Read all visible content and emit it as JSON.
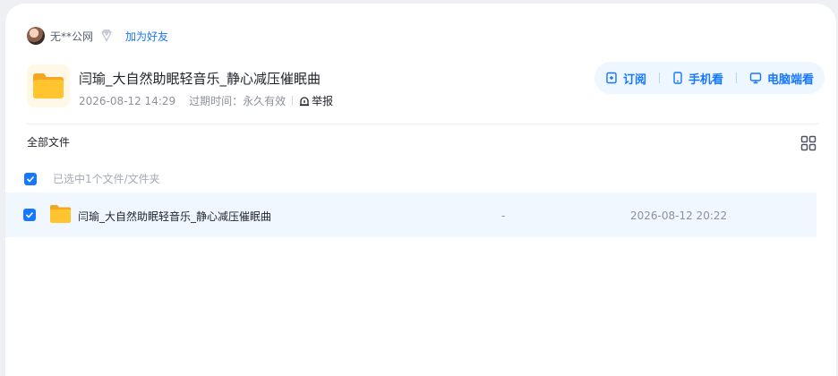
{
  "user": {
    "name": "无**公网",
    "add_friend": "加为好友"
  },
  "share": {
    "title": "闫瑜_大自然助眠轻音乐_静心减压催眠曲",
    "created": "2026-08-12 14:29",
    "expiry_label": "过期时间：",
    "expiry_value": "永久有效",
    "report": "举报"
  },
  "actions": {
    "subscribe": "订阅",
    "mobile": "手机看",
    "desktop": "电脑端看"
  },
  "list": {
    "breadcrumb": "全部文件",
    "selection_text": "已选中1个文件/文件夹",
    "files": [
      {
        "name": "闫瑜_大自然助眠轻音乐_静心减压催眠曲",
        "size": "-",
        "date": "2026-08-12 20:22",
        "selected": true
      }
    ]
  },
  "colors": {
    "accent": "#1677ff",
    "action_bg": "#eef6ff",
    "row_selected_bg": "#f1f7fe",
    "folder": "#ffc42e"
  },
  "icons": [
    "avatar",
    "vip-diamond-icon",
    "folder-icon",
    "report-icon",
    "subscribe-icon",
    "phone-icon",
    "monitor-icon",
    "grid-view-icon",
    "checkbox-checked-icon"
  ]
}
